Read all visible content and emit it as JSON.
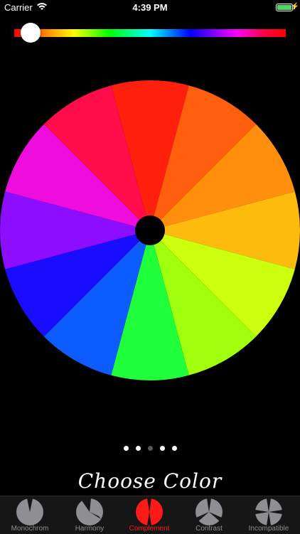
{
  "status_bar": {
    "carrier": "Carrier",
    "time": "4:39 PM"
  },
  "hue_slider": {
    "value_fraction": 0.06
  },
  "color_wheel": {
    "segments": [
      "#ff1f0d",
      "#ff5e0d",
      "#ff8f0d",
      "#ffbb0d",
      "#ccff0d",
      "#a0ff0d",
      "#1fff3a",
      "#0d5cff",
      "#1a0dff",
      "#8c0dff",
      "#ef0ddd",
      "#ff0d4a"
    ]
  },
  "pager": {
    "count": 5,
    "current": 2
  },
  "title": "Choose Color",
  "tabs": [
    {
      "label": "Monochrom",
      "icon": "monochrom-icon"
    },
    {
      "label": "Harmony",
      "icon": "harmony-icon"
    },
    {
      "label": "Complement",
      "icon": "complement-icon",
      "active": true
    },
    {
      "label": "Contrast",
      "icon": "contrast-icon"
    },
    {
      "label": "Incompatible",
      "icon": "incompatible-icon"
    }
  ],
  "colors": {
    "accent": "#ff1a1a",
    "inactive": "#8e8e93",
    "background": "#000000"
  }
}
